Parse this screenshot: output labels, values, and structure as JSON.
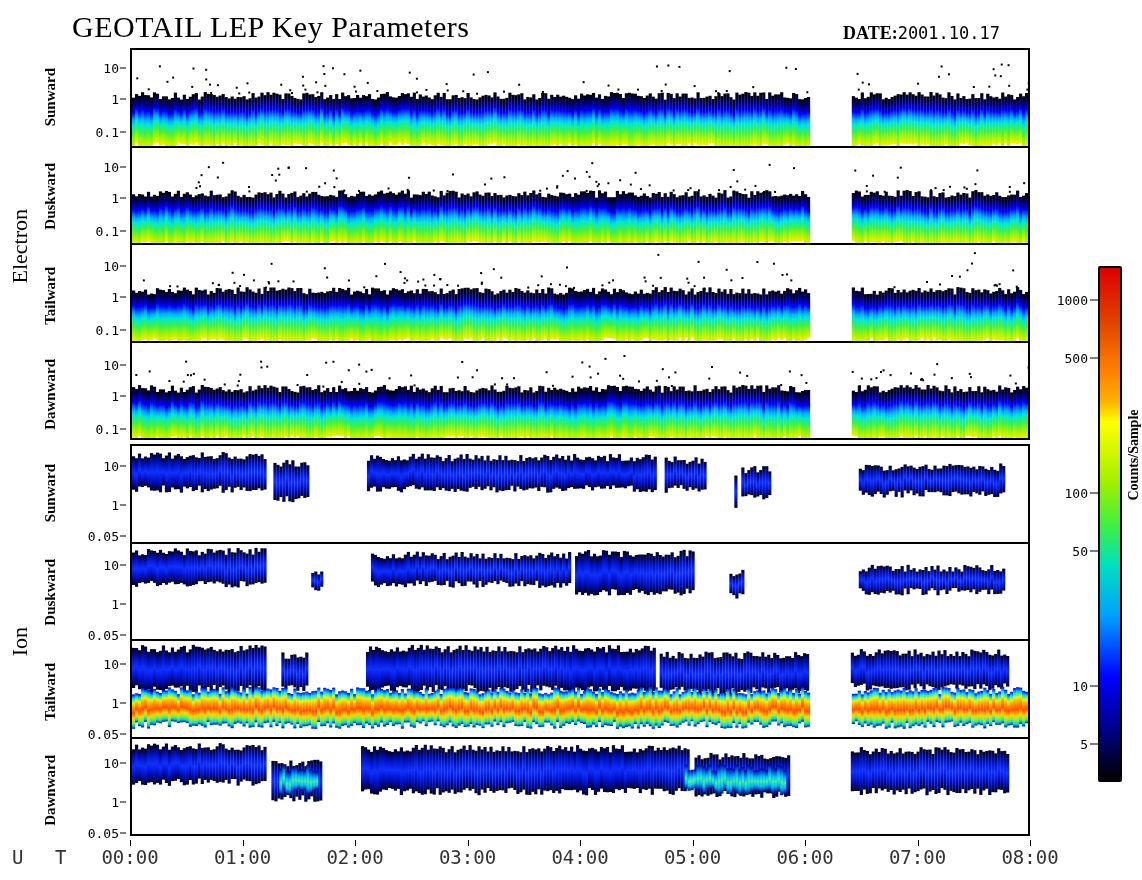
{
  "title": "GEOTAIL LEP Key Parameters",
  "date": "**DATE:**2001.10.17",
  "groups": [
    {
      "label": "Electron",
      "panels": [
        {
          "label": "Sunward",
          "kind": "electron",
          "yticks": [
            "10",
            "1",
            "0.1"
          ]
        },
        {
          "label": "Duskward",
          "kind": "electron",
          "yticks": [
            "10",
            "1",
            "0.1"
          ]
        },
        {
          "label": "Tailward",
          "kind": "electron",
          "yticks": [
            "10",
            "1",
            "0.1"
          ]
        },
        {
          "label": "Dawnward",
          "kind": "electron",
          "yticks": [
            "10",
            "1",
            "0.1"
          ]
        }
      ]
    },
    {
      "label": "Ion",
      "panels": [
        {
          "label": "Sunward",
          "kind": "ion",
          "yticks": [
            "10",
            "1",
            "0.05"
          ]
        },
        {
          "label": "Duskward",
          "kind": "ion",
          "yticks": [
            "10",
            "1",
            "0.05"
          ]
        },
        {
          "label": "Tailward",
          "kind": "ion_beam",
          "yticks": [
            "10",
            "1",
            "0.05"
          ]
        },
        {
          "label": "Dawnward",
          "kind": "ion",
          "yticks": [
            "10",
            "1",
            "0.05"
          ]
        }
      ]
    }
  ],
  "x_axis": {
    "label": "U T",
    "ticks": [
      "00:00",
      "01:00",
      "02:00",
      "03:00",
      "04:00",
      "05:00",
      "06:00",
      "07:00",
      "08:00"
    ]
  },
  "color_scale": {
    "label": "Counts/Sample",
    "ticks": [
      "1000",
      "500",
      "100",
      "50",
      "10",
      "5"
    ]
  }
}
